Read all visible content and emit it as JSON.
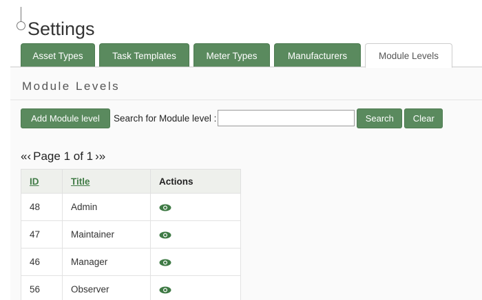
{
  "page": {
    "title": "Settings"
  },
  "tabs": [
    {
      "label": "Asset Types"
    },
    {
      "label": "Task Templates"
    },
    {
      "label": "Meter Types"
    },
    {
      "label": "Manufacturers"
    },
    {
      "label": "Module Levels",
      "active": true
    }
  ],
  "section": {
    "title": "Module Levels"
  },
  "toolbar": {
    "add_label": "Add Module level",
    "search_label": "Search for Module level :",
    "search_value": "",
    "search_button": "Search",
    "clear_button": "Clear"
  },
  "pager": {
    "first": "«",
    "prev": "‹",
    "text": "Page 1 of 1",
    "next": "›",
    "last": "»"
  },
  "table": {
    "headers": [
      "ID",
      "Title",
      "Actions"
    ],
    "rows": [
      {
        "id": "48",
        "title": "Admin",
        "action_icon": "eye-icon"
      },
      {
        "id": "47",
        "title": "Maintainer",
        "action_icon": "eye-icon"
      },
      {
        "id": "46",
        "title": "Manager",
        "action_icon": "eye-icon"
      },
      {
        "id": "56",
        "title": "Observer",
        "action_icon": "eye-icon"
      }
    ]
  },
  "colors": {
    "accent": "#5a8a5e",
    "link": "#3f7a45",
    "header_bg": "#eef0ec"
  }
}
